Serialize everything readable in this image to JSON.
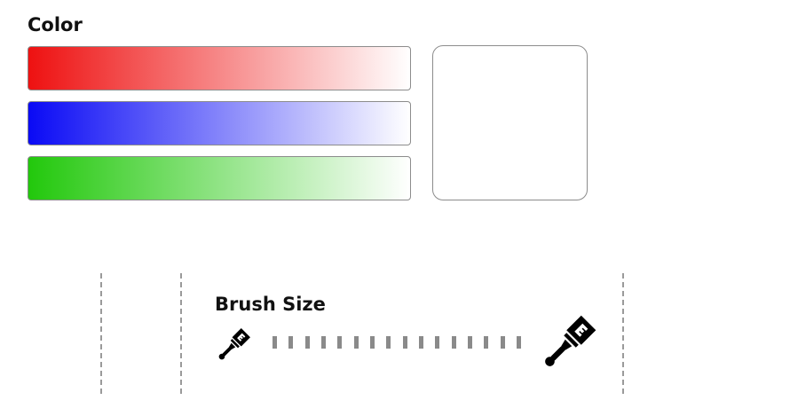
{
  "color_section": {
    "title": "Color",
    "channels": [
      {
        "name": "red",
        "color": "#ee1111"
      },
      {
        "name": "blue",
        "color": "#0a0af5"
      },
      {
        "name": "green",
        "color": "#22c80c"
      }
    ],
    "preview_color": "#ffffff"
  },
  "brush_section": {
    "title": "Brush Size",
    "min_icon": "paint-brush-icon",
    "max_icon": "paint-brush-icon",
    "tick_count": 16,
    "tick_color": "#8a8a8a"
  }
}
